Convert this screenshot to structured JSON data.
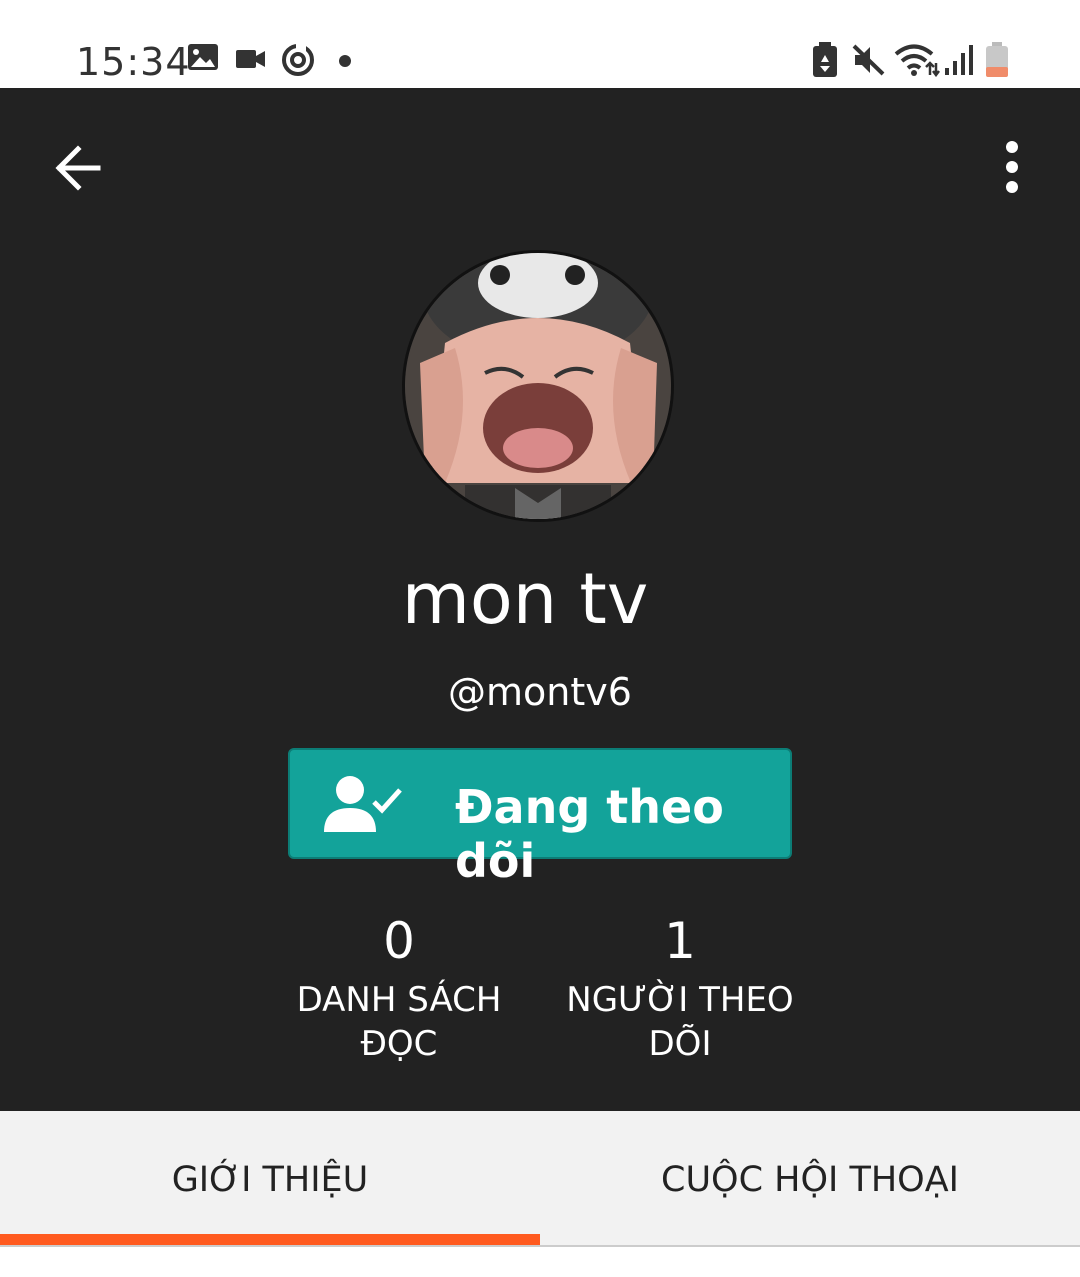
{
  "status_bar": {
    "time": "15:34",
    "left_icons": [
      "gallery-icon",
      "video-camera-icon",
      "sync-icon",
      "dot-icon"
    ],
    "right_icons": [
      "battery-saver-icon",
      "mute-icon",
      "wifi-icon",
      "signal-icon",
      "battery-icon"
    ]
  },
  "toolbar": {
    "back_icon": "arrow-left-icon",
    "menu_icon": "more-vertical-icon"
  },
  "profile": {
    "display_name": "mon tv",
    "username": "@montv6"
  },
  "follow_button": {
    "label": "Đang theo dõi",
    "icon": "user-check-icon"
  },
  "stats": [
    {
      "value": "0",
      "label_line1": "DANH SÁCH",
      "label_line2": "ĐỌC"
    },
    {
      "value": "1",
      "label_line1": "NGƯỜI THEO",
      "label_line2": "DÕI"
    }
  ],
  "tabs": [
    {
      "label": "GIỚI THIỆU",
      "active": true
    },
    {
      "label": "CUỘC HỘI THOẠI",
      "active": false
    }
  ],
  "colors": {
    "header_bg": "#222222",
    "follow_button": "#13a39a",
    "tab_indicator": "#ff5a1f"
  }
}
